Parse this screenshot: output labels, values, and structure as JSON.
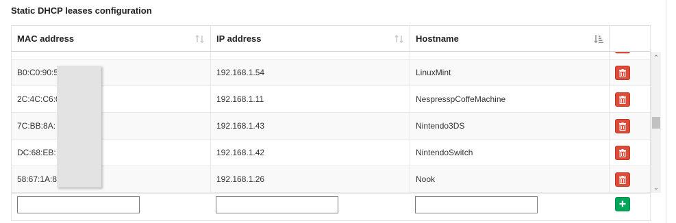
{
  "section": {
    "title": "Static DHCP leases configuration"
  },
  "columns": [
    {
      "label": "MAC address",
      "sort_icon": "sort-neutral-icon"
    },
    {
      "label": "IP address",
      "sort_icon": "sort-neutral-icon"
    },
    {
      "label": "Hostname",
      "sort_icon": "sort-alpha-desc-icon"
    }
  ],
  "rows": [
    {
      "mac": "",
      "ip": "",
      "host": ""
    },
    {
      "mac": "B0:C0:90:5",
      "ip": "192.168.1.54",
      "host": "LinuxMint"
    },
    {
      "mac": "2C:4C:C6:0",
      "ip": "192.168.1.11",
      "host": "NespresspCoffeMachine"
    },
    {
      "mac": "7C:BB:8A:",
      "ip": "192.168.1.43",
      "host": "Nintendo3DS"
    },
    {
      "mac": "DC:68:EB:",
      "ip": "192.168.1.42",
      "host": "NintendoSwitch"
    },
    {
      "mac": "58:67:1A:8",
      "ip": "192.168.1.26",
      "host": "Nook"
    }
  ],
  "icons": {
    "delete": "trash-icon",
    "add": "plus-icon"
  },
  "colors": {
    "delete_button": "#dd4b39",
    "add_button": "#00a65a"
  },
  "new_entry": {
    "mac_value": "",
    "ip_value": "",
    "host_value": ""
  }
}
